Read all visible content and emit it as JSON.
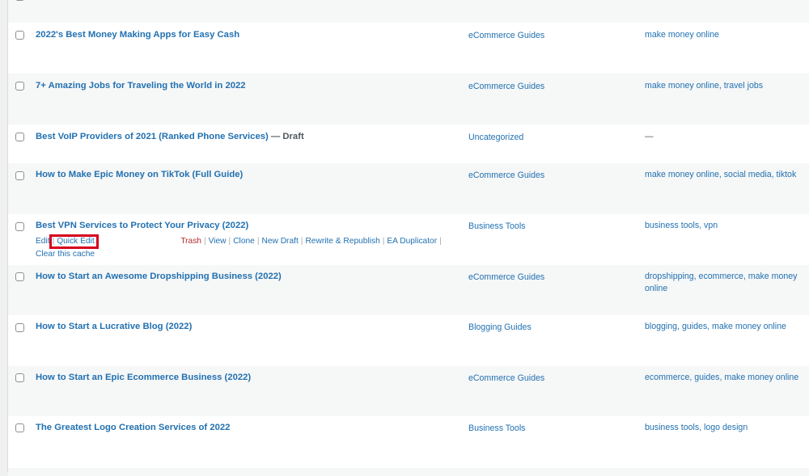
{
  "rows": [
    {
      "title": "2022's Best Money Making Apps for Easy Cash",
      "state": "",
      "category": "eCommerce Guides",
      "tags": "make money online"
    },
    {
      "title": "7+ Amazing Jobs for Traveling the World in 2022",
      "state": "",
      "category": "eCommerce Guides",
      "tags": "make money online, travel jobs"
    },
    {
      "title": "Best VoIP Providers of 2021 (Ranked Phone Services)",
      "state": "— Draft",
      "category": "Uncategorized",
      "tags": "—"
    },
    {
      "title": "How to Make Epic Money on TikTok (Full Guide)",
      "state": "",
      "category": "eCommerce Guides",
      "tags": "make money online, social media, tiktok"
    },
    {
      "title": "Best VPN Services to Protect Your Privacy (2022)",
      "state": "",
      "category": "Business Tools",
      "tags": "business tools, vpn"
    },
    {
      "title": "How to Start an Awesome Dropshipping Business (2022)",
      "state": "",
      "category": "eCommerce Guides",
      "tags": "dropshipping, ecommerce, make money online"
    },
    {
      "title": "How to Start a Lucrative Blog (2022)",
      "state": "",
      "category": "Blogging Guides",
      "tags": "blogging, guides, make money online"
    },
    {
      "title": "How to Start an Epic Ecommerce Business (2022)",
      "state": "",
      "category": "eCommerce Guides",
      "tags": "ecommerce, guides, make money online"
    },
    {
      "title": "The Greatest Logo Creation Services of 2022",
      "state": "",
      "category": "Business Tools",
      "tags": "business tools, logo design"
    }
  ],
  "row_actions": {
    "edit": "Edit",
    "quick_edit": "Quick Edit",
    "trash": "Trash",
    "view": "View",
    "clone": "Clone",
    "new_draft": "New Draft",
    "rewrite": "Rewrite & Republish",
    "ea_duplicator": "EA Duplicator",
    "separator": "|",
    "clear_cache": "Clear this cache"
  },
  "colors": {
    "link": "#2271b1",
    "trash": "#b32d2e",
    "highlight": "#d6001c"
  }
}
